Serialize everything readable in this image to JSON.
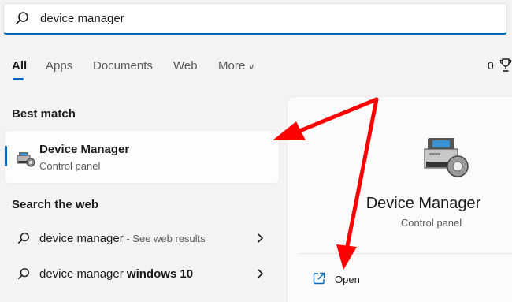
{
  "search": {
    "query": "device manager",
    "icon": "search-icon"
  },
  "tabs": [
    {
      "label": "All",
      "active": true
    },
    {
      "label": "Apps"
    },
    {
      "label": "Documents"
    },
    {
      "label": "Web"
    },
    {
      "label": "More"
    }
  ],
  "header": {
    "points": "0"
  },
  "best_match": {
    "heading": "Best match",
    "title": "Device Manager",
    "subtitle": "Control panel"
  },
  "search_web": {
    "heading": "Search the web",
    "items": [
      {
        "prefix": "device manager",
        "bold": "",
        "hint": " - See web results"
      },
      {
        "prefix": "device manager ",
        "bold": "windows 10",
        "hint": ""
      }
    ]
  },
  "preview": {
    "title": "Device Manager",
    "subtitle": "Control panel",
    "open_label": "Open"
  },
  "colors": {
    "accent": "#0067c0",
    "annotation": "#ff0000"
  }
}
